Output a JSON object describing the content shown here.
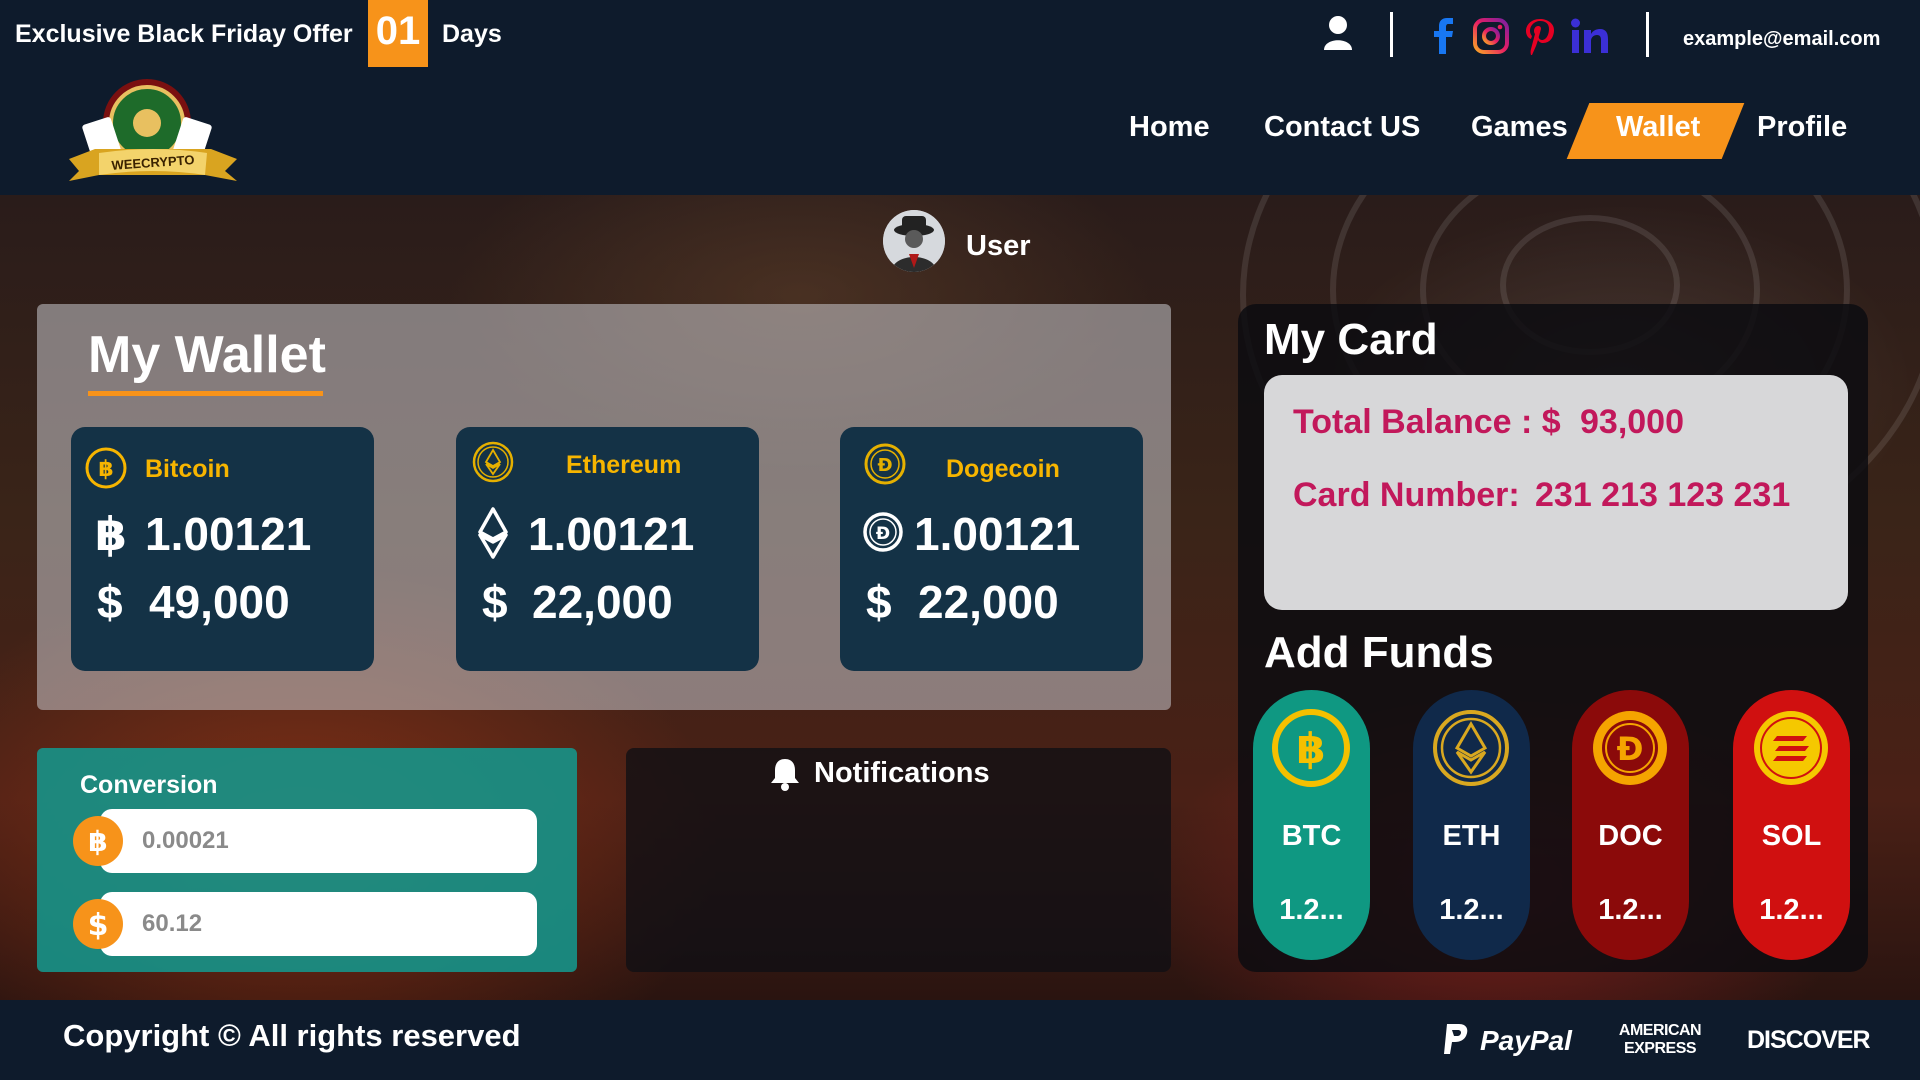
{
  "topbar": {
    "offer_text": "Exclusive Black Friday Offer",
    "days_count": "01",
    "days_label": "Days",
    "email": "example@email.com"
  },
  "nav": {
    "items": [
      {
        "label": "Home",
        "active": false
      },
      {
        "label": "Contact US",
        "active": false
      },
      {
        "label": "Games",
        "active": false
      },
      {
        "label": "Wallet",
        "active": true
      },
      {
        "label": "Profile",
        "active": false
      }
    ],
    "logo_text": "WEECRYPTO"
  },
  "user": {
    "name": "User"
  },
  "wallet": {
    "title": "My Wallet",
    "coins": [
      {
        "name": "Bitcoin",
        "symbol": "฿",
        "amount": "1.00121",
        "usd_symbol": "$",
        "usd": "49,000"
      },
      {
        "name": "Ethereum",
        "symbol": "",
        "amount": "1.00121",
        "usd_symbol": "$",
        "usd": "22,000"
      },
      {
        "name": "Dogecoin",
        "symbol": "",
        "amount": "1.00121",
        "usd_symbol": "$",
        "usd": "22,000"
      }
    ]
  },
  "conversion": {
    "title": "Conversion",
    "btc_value": "0.00021",
    "usd_value": "60.12"
  },
  "notifications": {
    "title": "Notifications"
  },
  "my_card": {
    "title": "My Card",
    "total_balance_label": "Total Balance : $",
    "total_balance": "93,000",
    "card_number_label": "Card Number:",
    "card_number": "231 213 123 231"
  },
  "add_funds": {
    "title": "Add Funds",
    "items": [
      {
        "label": "BTC",
        "value": "1.2..."
      },
      {
        "label": "ETH",
        "value": "1.2..."
      },
      {
        "label": "DOC",
        "value": "1.2..."
      },
      {
        "label": "SOL",
        "value": "1.2..."
      }
    ]
  },
  "footer": {
    "copyright": "Copyright",
    "copy_symbol": "©",
    "rights": "All rights reserved",
    "payments": [
      "PayPal",
      "AMERICAN EXPRESS",
      "DISCOVER"
    ]
  },
  "colors": {
    "accent": "#f7931a",
    "navy": "#0e1b2c",
    "card_bg": "#143246",
    "balance_text": "#c2185b",
    "btc_pill": "#0f9882",
    "eth_pill": "#10294a",
    "doc_pill": "#8b0a0a",
    "sol_pill": "#d01010"
  }
}
